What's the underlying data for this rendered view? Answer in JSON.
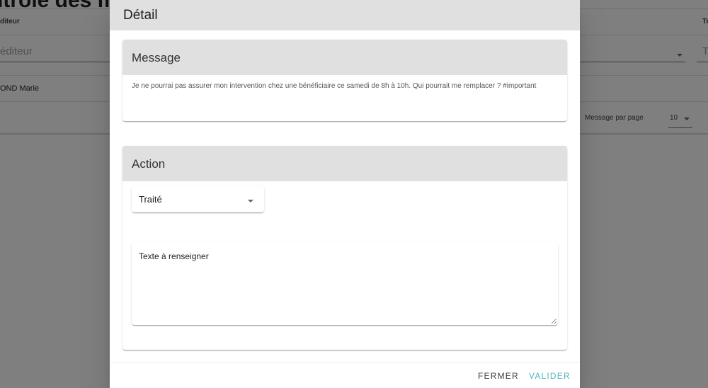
{
  "background": {
    "page_title": "ntrole des mes",
    "column_editor": "diteur",
    "column_right": "Tr",
    "editor_placeholder": "éditeur",
    "right_input_placeholder": "T",
    "row_editor": "OND Marie",
    "pagination_label": "Message par page",
    "pagination_value": "10"
  },
  "dialog": {
    "title": "Détail",
    "message_card": {
      "title": "Message",
      "text": "Je ne pourrai pas assurer mon intervention chez une bénéficiaire ce samedi de 8h à 10h. Qui pourrait me remplacer ? #important"
    },
    "action_card": {
      "title": "Action",
      "status_value": "Traité",
      "textarea_placeholder": "Texte à renseigner"
    },
    "buttons": {
      "close": "FERMER",
      "validate": "VALIDER"
    }
  },
  "colors": {
    "header_gray": "#e0e0e0",
    "accent": "#4fb6bd",
    "overlay": "rgba(0,0,0,0.5)"
  },
  "icons": {
    "status_dropdown": "chevron-down-icon",
    "pagination_dropdown": "chevron-down-icon",
    "editor_dropdown": "chevron-down-icon",
    "textarea_resize": "resize-handle-icon"
  }
}
